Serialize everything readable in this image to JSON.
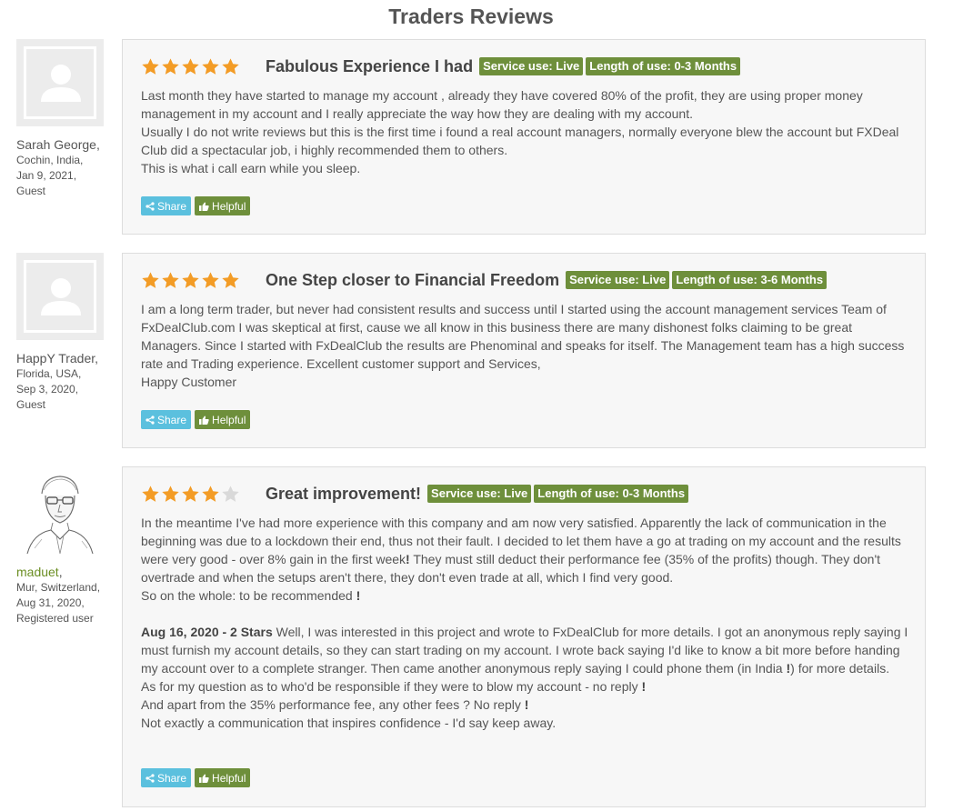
{
  "page": {
    "title": "Traders Reviews"
  },
  "colors": {
    "star": "#f39c26",
    "star_empty": "#d9d9d9",
    "badge": "#6e8f3b",
    "share": "#5bc0de",
    "card_bg": "#f7f7f7"
  },
  "buttons": {
    "share": "Share",
    "helpful": "Helpful"
  },
  "reviews": [
    {
      "author": "Sarah George,",
      "location": "Cochin, India,",
      "date": "Jan 9, 2021,",
      "role": "Guest",
      "avatar": "default-user-icon",
      "rating": 5,
      "title": "Fabulous Experience I had",
      "service_use": "Service use: Live",
      "length_of_use": "Length of use: 0-3 Months",
      "body": [
        "Last month they have started to manage my account , already they have covered 80% of the profit, they are using proper money management in my account and I really appreciate the way how they are dealing with my account.",
        "Usually I do not write reviews but this is the first time i found a real account managers, normally everyone blew the account but FXDeal Club did a spectacular job, i highly recommended them to others.",
        "This is what i call earn while you sleep."
      ]
    },
    {
      "author": "HappY Trader,",
      "location": "Florida, USA,",
      "date": "Sep 3, 2020,",
      "role": "Guest",
      "avatar": "default-user-icon",
      "rating": 5,
      "title": "One Step closer to Financial Freedom",
      "service_use": "Service use: Live",
      "length_of_use": "Length of use: 3-6 Months",
      "body": [
        "I am a long term trader, but never had consistent results and success until I started using the account management services Team of FxDealClub.com I was skeptical at first, cause we all know in this business there are many dishonest folks claiming to be great Managers. Since I started with FxDealClub the results are Phenominal and speaks for itself. The Management team has a high success rate and Trading experience. Excellent customer support and Services,",
        "Happy Customer"
      ]
    },
    {
      "author": "maduet",
      "author_suffix": ",",
      "location": "Mur, Switzerland,",
      "date": "Aug 31, 2020,",
      "role": "Registered user",
      "avatar": "sketch-portrait",
      "rating": 4,
      "title": "Great improvement!",
      "service_use": "Service use: Live",
      "length_of_use": "Length of use: 0-3 Months",
      "body": [
        "In the meantime I've had more experience with this company and am now very satisfied. Apparently the lack of communication in the beginning was due to a lockdown their end, thus not their fault. I decided to let them have a go at trading on my account and the results were very good - over 8% gain in the first week",
        "They must still deduct their performance fee (35% of the profits) though. They don't overtrade and when the setups aren't there, they don't even trade at all, which I find very good.",
        "So on the whole: to be recommended "
      ],
      "update_heading": "Aug 16, 2020 - 2 Stars",
      "update_body": [
        "Well, I was interested in this project and wrote to FxDealClub for more details. I got an anonymous reply saying I must furnish my account details, so they can start trading on my account. I wrote back saying I'd like to know a bit more before handing my account over to a complete stranger. Then came another anonymous reply saying I could phone them (in India ",
        ") for more details.",
        "As for my question as to who'd be responsible if they were to blow my account - no reply ",
        "And apart from the 35% performance fee, any other fees ? No reply ",
        "Not exactly a communication that inspires confidence - I'd say keep away."
      ],
      "exclamation": "!"
    }
  ]
}
